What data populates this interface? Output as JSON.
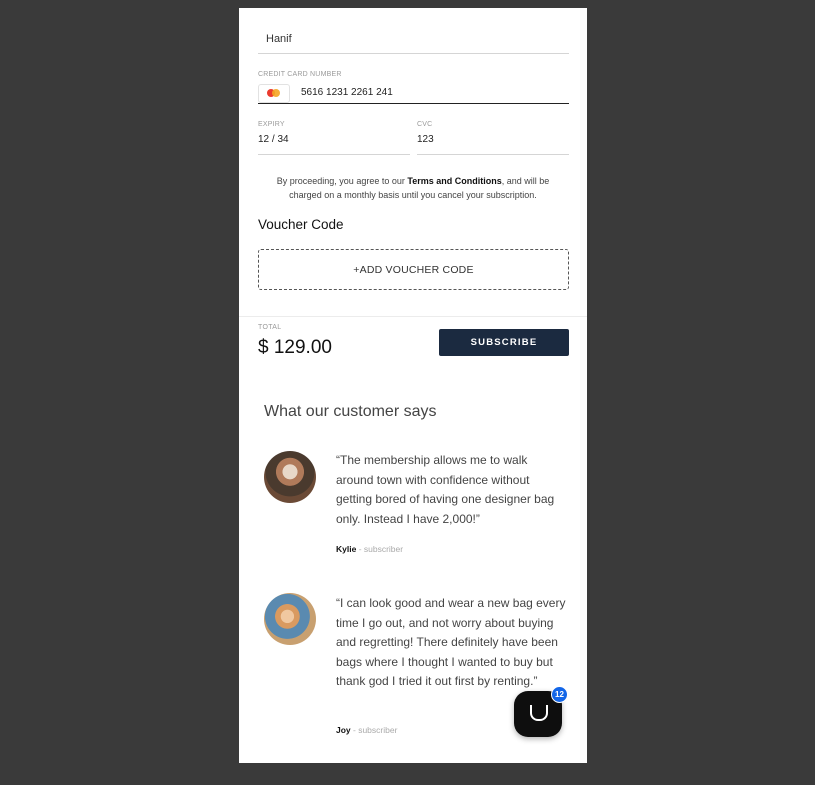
{
  "form": {
    "name_value": "Hanif",
    "card_label": "CREDIT CARD NUMBER",
    "card_number": "5616 1231 2261 241",
    "card_brand_icon": "mastercard-icon",
    "expiry_label": "EXPIRY",
    "expiry_value": "12 / 34",
    "cvc_label": "CVC",
    "cvc_value": "123"
  },
  "terms": {
    "prefix": "By proceeding, you agree to our ",
    "link": "Terms and Conditions",
    "suffix": ", and will be charged on a monthly basis until you cancel your subscription."
  },
  "voucher": {
    "title": "Voucher Code",
    "button": "+ADD VOUCHER CODE"
  },
  "checkout": {
    "total_label": "TOTAL",
    "total_value": "$ 129.00",
    "subscribe_label": "SUBSCRIBE",
    "accent": "#1b2a40"
  },
  "testimonials": {
    "title": "What our customer says",
    "items": [
      {
        "quote": "“The membership allows me to walk around town with confidence without getting bored of having one designer bag only. Instead I have 2,000!”",
        "name": "Kylie",
        "role": " - subscriber"
      },
      {
        "quote": "“I can look good and wear a new bag every time I go out, and not worry about buying and regretting! There definitely have been bags where I thought I wanted to buy but thank god I tried it out first by renting.”",
        "name": "Joy",
        "role": " - subscriber"
      }
    ]
  },
  "chat": {
    "icon": "chat-smile-icon",
    "badge": "12",
    "badge_color": "#1366e8"
  }
}
